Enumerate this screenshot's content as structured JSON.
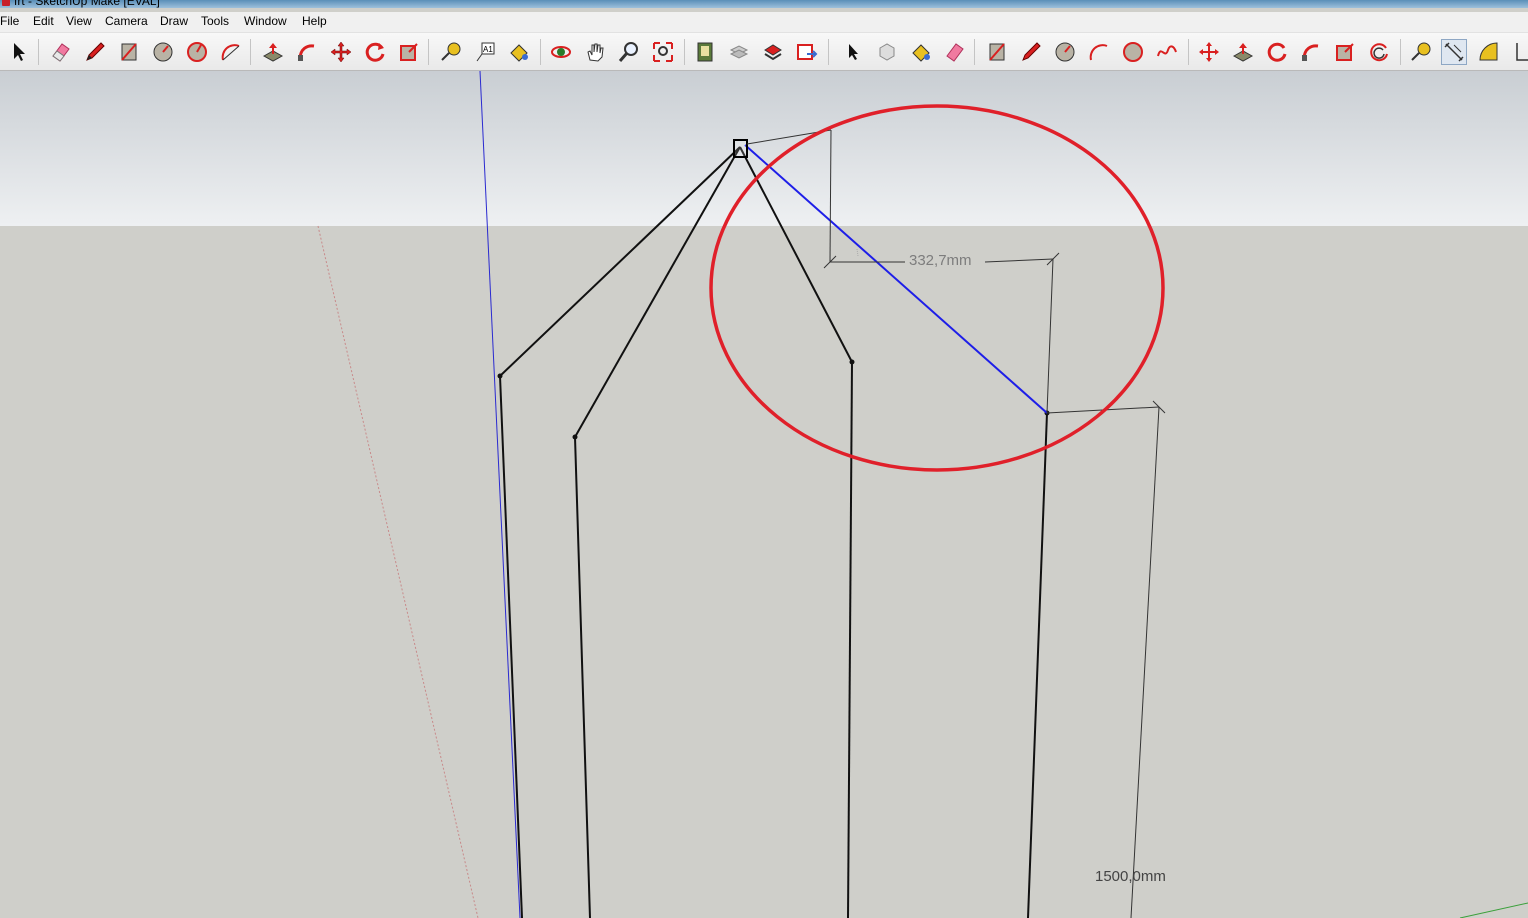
{
  "window": {
    "title": "frt - SketchUp Make [EVAL]"
  },
  "menu": [
    "File",
    "Edit",
    "View",
    "Camera",
    "Draw",
    "Tools",
    "Window",
    "Help"
  ],
  "toolbar_icons": [
    "select-icon",
    "eraser-icon",
    "pencil-icon",
    "rectangle-icon",
    "circle-icon",
    "polygon-icon",
    "arc-icon",
    "push-pull-icon",
    "follow-me-icon",
    "move-icon",
    "rotate-icon",
    "scale-icon",
    "tape-measure-icon",
    "text-icon",
    "paint-bucket-icon",
    "orbit-icon",
    "pan-icon",
    "zoom-icon",
    "zoom-extents-icon",
    "get-models-icon",
    "share-model-icon",
    "components-icon",
    "export-icon",
    "select-icon",
    "make-component-icon",
    "paint-bucket-icon",
    "eraser-icon",
    "rectangle-icon",
    "line-icon",
    "circle-icon",
    "arc-icon",
    "polygon-icon",
    "freehand-icon",
    "move-icon",
    "push-pull-icon",
    "rotate-icon",
    "follow-me-icon",
    "scale-icon",
    "offset-icon",
    "tape-measure-icon",
    "dimension-icon",
    "protractor-icon",
    "axes-icon"
  ],
  "colors": {
    "annotation": "#e0202a",
    "selected_edge": "#1e1ee8",
    "sky": "#dfe3e7",
    "ground": "#cfcfca"
  },
  "dimensions": {
    "top": "332,7mm",
    "bottom": "1500,0mm"
  }
}
